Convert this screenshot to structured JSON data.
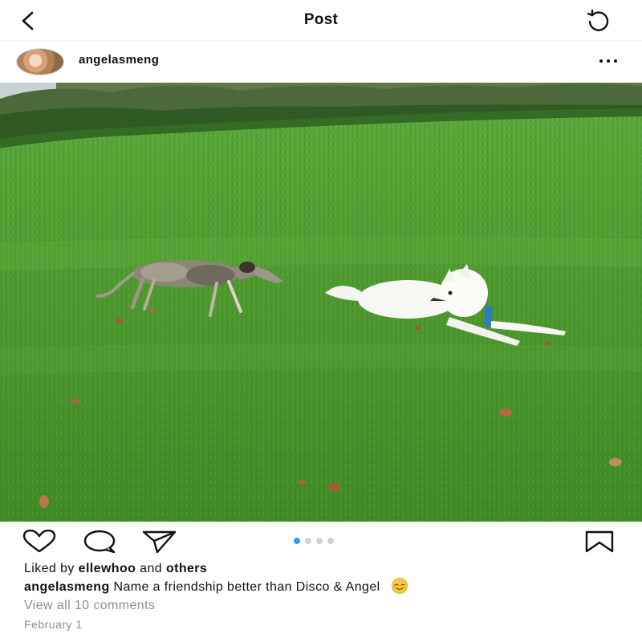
{
  "header": {
    "title": "Post",
    "back_icon": "chevron-left-icon",
    "refresh_icon": "refresh-icon"
  },
  "post": {
    "username": "angelasmeng",
    "more_icon": "more-horizontal-icon",
    "photo_description": "",
    "carousel": {
      "count": 4,
      "active_index": 0
    },
    "liked_by_prefix": "Liked by",
    "liked_by_user": "ellewhoo",
    "liked_by_connector": "and",
    "liked_by_others": "others",
    "caption_user": "angelasmeng",
    "caption_text": "Name a friendship better than Disco & Angel",
    "caption_emoji": "relieved-face-emoji",
    "view_comments": "View all 10 comments",
    "date": "February 1"
  },
  "colors": {
    "accent_blue": "#3897f0",
    "muted_text": "#8e8e8e",
    "grass": "#4f9a2f"
  }
}
